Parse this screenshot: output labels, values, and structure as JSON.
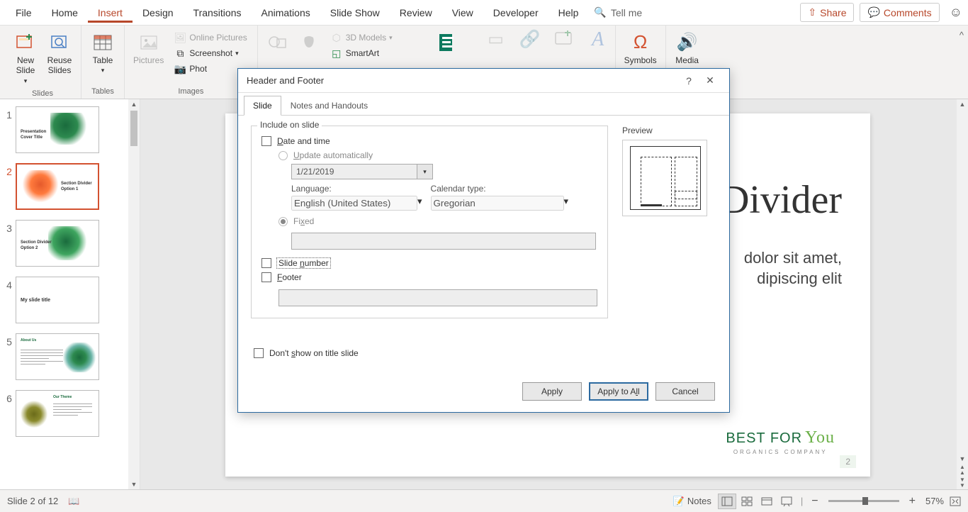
{
  "menu": {
    "file": "File",
    "home": "Home",
    "insert": "Insert",
    "design": "Design",
    "transitions": "Transitions",
    "animations": "Animations",
    "slideshow": "Slide Show",
    "review": "Review",
    "view": "View",
    "developer": "Developer",
    "help": "Help",
    "tellme": "Tell me",
    "share": "Share",
    "comments": "Comments"
  },
  "ribbon": {
    "new_slide": "New\nSlide",
    "reuse_slides": "Reuse\nSlides",
    "table": "Table",
    "pictures": "Pictures",
    "online_pictures": "Online Pictures",
    "screenshot": "Screenshot",
    "photo": "Phot",
    "models3d": "3D Models",
    "smartart": "SmartArt",
    "symbols": "Symbols",
    "media": "Media",
    "grp_slides": "Slides",
    "grp_tables": "Tables",
    "grp_images": "Images"
  },
  "slides": {
    "t1": "Presentation\nCover Title",
    "t2": "Section Divider\nOption 1",
    "t3": "Section Divider\nOption 2",
    "t4": "My slide title",
    "t5": "About Us",
    "t6": "Our Theme"
  },
  "canvas": {
    "title": "Divider",
    "sub1": "dolor sit amet,",
    "sub2": "dipiscing elit",
    "brand1": "BEST FOR",
    "brand_you": "You",
    "brand2": "ORGANICS COMPANY",
    "page": "2"
  },
  "dialog": {
    "title": "Header and Footer",
    "tab_slide": "Slide",
    "tab_notes": "Notes and Handouts",
    "include": "Include on slide",
    "date_time": "Date and time",
    "update_auto": "Update automatically",
    "date_val": "1/21/2019",
    "language": "Language:",
    "language_val": "English (United States)",
    "calendar": "Calendar type:",
    "calendar_val": "Gregorian",
    "fixed": "Fixed",
    "slide_number": "Slide number",
    "footer": "Footer",
    "dont_show": "Don't show on title slide",
    "preview": "Preview",
    "apply": "Apply",
    "apply_all": "Apply to All",
    "cancel": "Cancel"
  },
  "status": {
    "slide": "Slide 2 of 12",
    "notes": "Notes",
    "zoom": "57%"
  }
}
